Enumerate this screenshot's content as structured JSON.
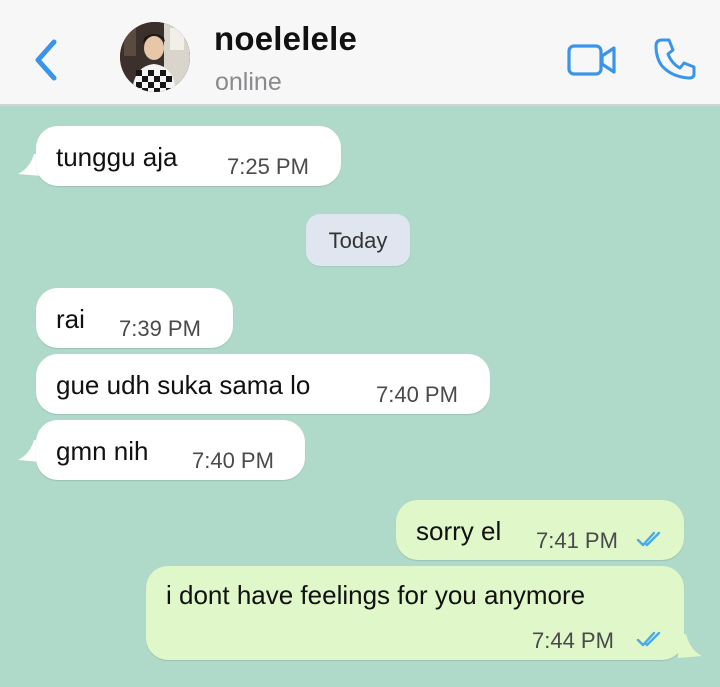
{
  "header": {
    "contact_name": "noelelele",
    "status": "online",
    "icons": {
      "back": "chevron-left-icon",
      "video": "video-call-icon",
      "phone": "voice-call-icon"
    }
  },
  "chat": {
    "date_separator": "Today",
    "messages": [
      {
        "direction": "incoming",
        "text": "tunggu aja",
        "time": "7:25 PM"
      },
      {
        "direction": "incoming",
        "text": "rai",
        "time": "7:39 PM"
      },
      {
        "direction": "incoming",
        "text": "gue udh suka sama lo",
        "time": "7:40 PM"
      },
      {
        "direction": "incoming",
        "text": "gmn nih",
        "time": "7:40 PM"
      },
      {
        "direction": "outgoing",
        "text": "sorry el",
        "time": "7:41 PM",
        "status": "read"
      },
      {
        "direction": "outgoing",
        "text": "i dont have feelings for you anymore",
        "time": "7:44 PM",
        "status": "read"
      }
    ]
  },
  "colors": {
    "chat_background": "#afdaca",
    "incoming_bubble": "#ffffff",
    "outgoing_bubble": "#e0f7c9",
    "accent_blue": "#3a95ea",
    "read_tick": "#4aa9e8"
  }
}
